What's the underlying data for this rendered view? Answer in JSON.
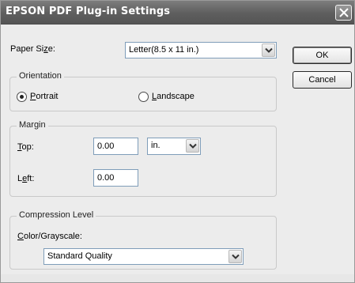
{
  "window": {
    "title": "EPSON PDF Plug-in Settings"
  },
  "paper_size": {
    "label": "Paper Size:",
    "value": "Letter(8.5 x 11 in.)"
  },
  "buttons": {
    "ok": "OK",
    "cancel": "Cancel"
  },
  "orientation": {
    "title": "Orientation",
    "portrait": "Portrait",
    "landscape": "Landscape",
    "selected": "Portrait"
  },
  "margin": {
    "title": "Margin",
    "top_label": "Top:",
    "top_value": "0.00",
    "unit": "in.",
    "left_label": "Left:",
    "left_value": "0.00"
  },
  "compression": {
    "title": "Compression Level",
    "color_label": "Color/Grayscale:",
    "color_value": "Standard Quality"
  },
  "icons": {
    "close": "close-icon",
    "dropdown": "chevron-down-icon",
    "radio": "radio-button-icon"
  }
}
